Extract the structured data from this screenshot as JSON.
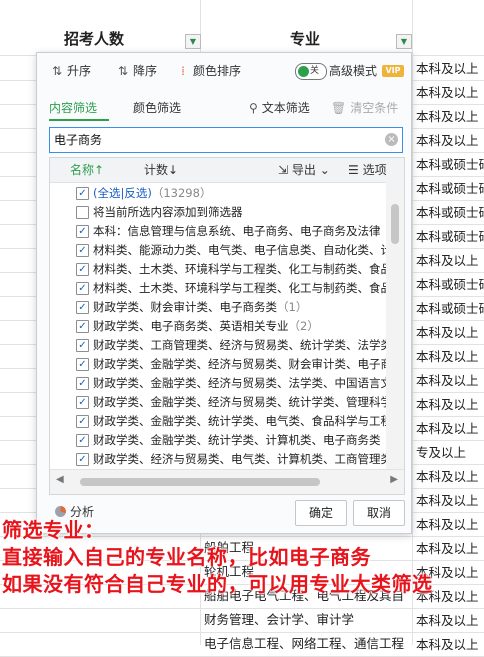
{
  "sheet": {
    "headers": [
      "招考人数",
      "专业"
    ],
    "right_column": [
      "本科及以上",
      "本科及以上",
      "本科及以上",
      "本科及以上",
      "本科或硕士研",
      "本科或硕士研",
      "本科或硕士研",
      "本科或硕士研",
      "本科及以上",
      "本科或硕士研",
      "本科或硕士研",
      "本科及以上",
      "本科及以上",
      "本科及以上",
      "本科及以上",
      "本科及以上",
      "专及以上",
      "本科及以上",
      "本科及以上",
      "本科及以上",
      "本科及以上",
      "本科及以上",
      "本科及以上",
      "本科及以上",
      "本科及以上"
    ],
    "bottom_rows": [
      "船舶工程",
      "轮机工程",
      "船舶电子电气工程、电气工程及其自",
      "财务管理、会计学、审计学",
      "电子信息工程、网络工程、通信工程"
    ]
  },
  "filter": {
    "toolbar": {
      "asc": "升序",
      "desc": "降序",
      "color_sort": "颜色排序",
      "toggle_label": "关",
      "advanced": "高级模式",
      "vip": "VIP"
    },
    "tabs": {
      "content": "内容筛选",
      "color": "颜色筛选",
      "text": "文本筛选",
      "clear": "清空条件"
    },
    "search_value": "电子商务",
    "list_header": {
      "name": "名称↑",
      "count": "计数↓",
      "export": "导出",
      "options": "选项"
    },
    "items": [
      {
        "text": "(全选|反选)",
        "count": "（13298）",
        "checked": true,
        "link": true
      },
      {
        "text": "将当前所选内容添加到筛选器",
        "count": "",
        "checked": false
      },
      {
        "text": "本科：信息管理与信息系统、电子商务、电子商务及法律",
        "count": "",
        "checked": true
      },
      {
        "text": "材料类、能源动力类、电气类、电子信息类、自动化类、计",
        "count": "",
        "checked": true
      },
      {
        "text": "材料类、土木类、环境科学与工程类、化工与制药类、食品",
        "count": "",
        "checked": true
      },
      {
        "text": "材料类、土木类、环境科学与工程类、化工与制药类、食品",
        "count": "",
        "checked": true
      },
      {
        "text": "财政学类、财会审计类、电子商务类",
        "count": "（1）",
        "checked": true
      },
      {
        "text": "财政学类、电子商务类、英语相关专业",
        "count": "（2）",
        "checked": true
      },
      {
        "text": "财政学类、工商管理类、经济与贸易类、统计学类、法学类",
        "count": "",
        "checked": true
      },
      {
        "text": "财政学类、金融学类、经济与贸易类、财会审计类、电子商",
        "count": "",
        "checked": true
      },
      {
        "text": "财政学类、金融学类、经济与贸易类、法学类、中国语言文",
        "count": "",
        "checked": true
      },
      {
        "text": "财政学类、金融学类、经济与贸易类、统计学类、管理科学",
        "count": "",
        "checked": true
      },
      {
        "text": "财政学类、金融学类、统计学类、电气类、食品科学与工程",
        "count": "",
        "checked": true
      },
      {
        "text": "财政学类、金融学类、统计学类、计算机类、电子商务类",
        "count": "",
        "checked": true
      },
      {
        "text": "财政学类、经济与贸易类、电气类、计算机类、工商管理类",
        "count": "",
        "checked": true
      },
      {
        "text": "财政学类、经济与贸易类、法学类、统计学类、电子商务类",
        "count": "",
        "checked": true
      }
    ],
    "analysis": "分析",
    "ok": "确定",
    "cancel": "取消"
  },
  "annotation": [
    "筛选专业：",
    "直接输入自己的专业名称，比如电子商务",
    "如果没有符合自己专业的，可以用专业大类筛选"
  ],
  "colors": {
    "accent": "#2da04e",
    "annotation": "#e8141c",
    "link": "#1a5fc4"
  }
}
